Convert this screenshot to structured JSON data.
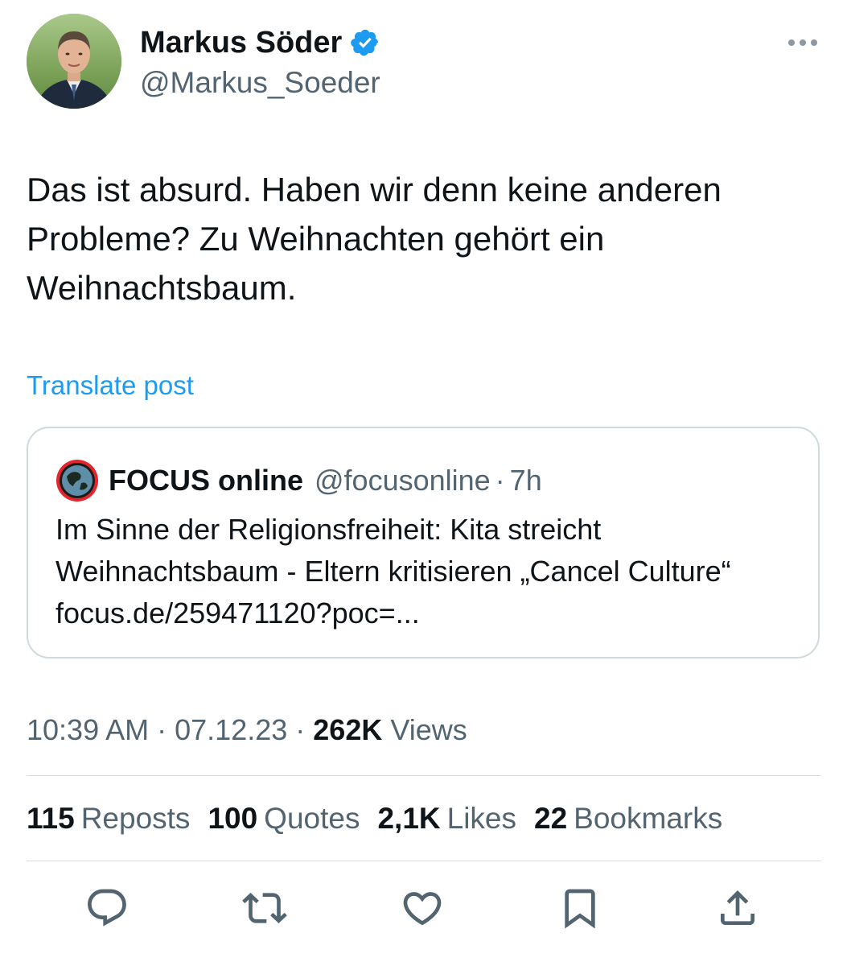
{
  "author": {
    "name": "Markus Söder",
    "handle": "@Markus_Soeder",
    "avatar_icon": "profile-photo",
    "verified_icon": "verified-badge-icon",
    "verified_color": "#1d9bf0"
  },
  "post": {
    "text": "Das ist absurd. Haben wir denn keine anderen Probleme? Zu Weihnachten gehört ein Weihnachtsbaum.",
    "translate_label": "Translate post",
    "time": "10:39 AM",
    "date": "07.12.23",
    "views_count": "262K",
    "views_label": "Views"
  },
  "quoted": {
    "name": "FOCUS online",
    "handle": "@focusonline",
    "separator": "·",
    "age": "7h",
    "text": "Im Sinne der Religionsfreiheit: Kita streicht Weihnachtsbaum - Eltern kritisieren „Cancel Culture“ focus.de/259471120?poc=..."
  },
  "stats": {
    "reposts_count": "115",
    "reposts_label": "Reposts",
    "quotes_count": "100",
    "quotes_label": "Quotes",
    "likes_count": "2,1K",
    "likes_label": "Likes",
    "bookmarks_count": "22",
    "bookmarks_label": "Bookmarks"
  },
  "actions": [
    "reply-icon",
    "repost-icon",
    "like-icon",
    "bookmark-icon",
    "share-icon"
  ],
  "colors": {
    "text": "#0f1419",
    "secondary": "#536471",
    "link": "#1d9bf0",
    "border": "#cfd9de"
  }
}
